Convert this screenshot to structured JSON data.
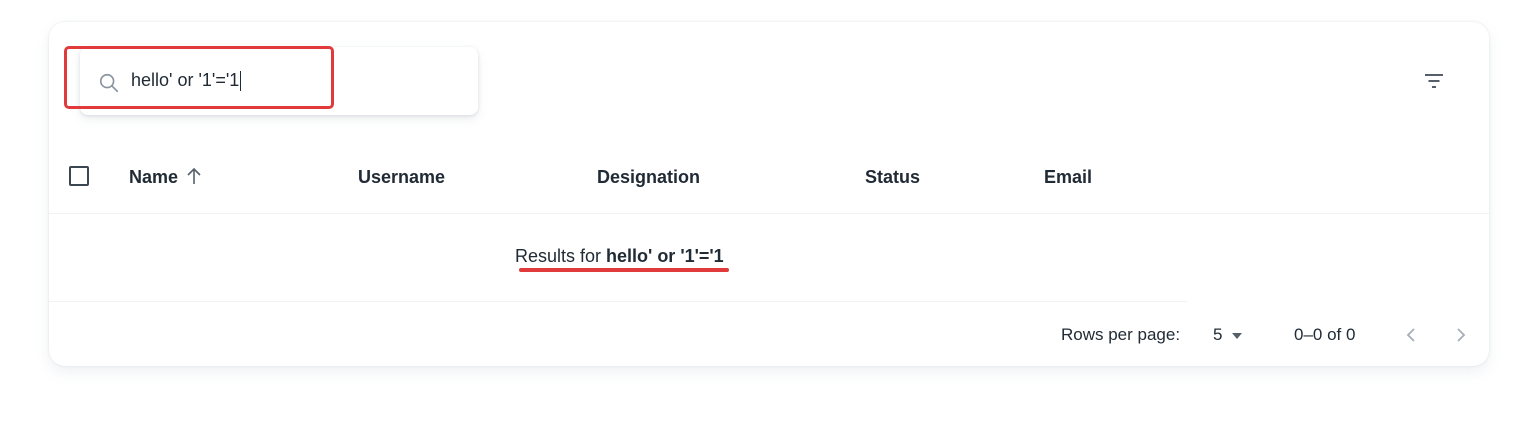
{
  "search": {
    "value": "hello' or '1'='1",
    "icon": "search-icon"
  },
  "toolbar": {
    "filter_icon": "filter-list-icon"
  },
  "table": {
    "columns": [
      "Name",
      "Username",
      "Designation",
      "Status",
      "Email"
    ],
    "sort_icon": "arrow-up-icon",
    "empty_prefix": "Results for ",
    "empty_query": "hello' or '1'='1"
  },
  "pagination": {
    "rows_label": "Rows per page:",
    "rows_value": "5",
    "range": "0–0 of 0"
  },
  "annotations": {
    "highlight_color": "#e03a3a"
  }
}
